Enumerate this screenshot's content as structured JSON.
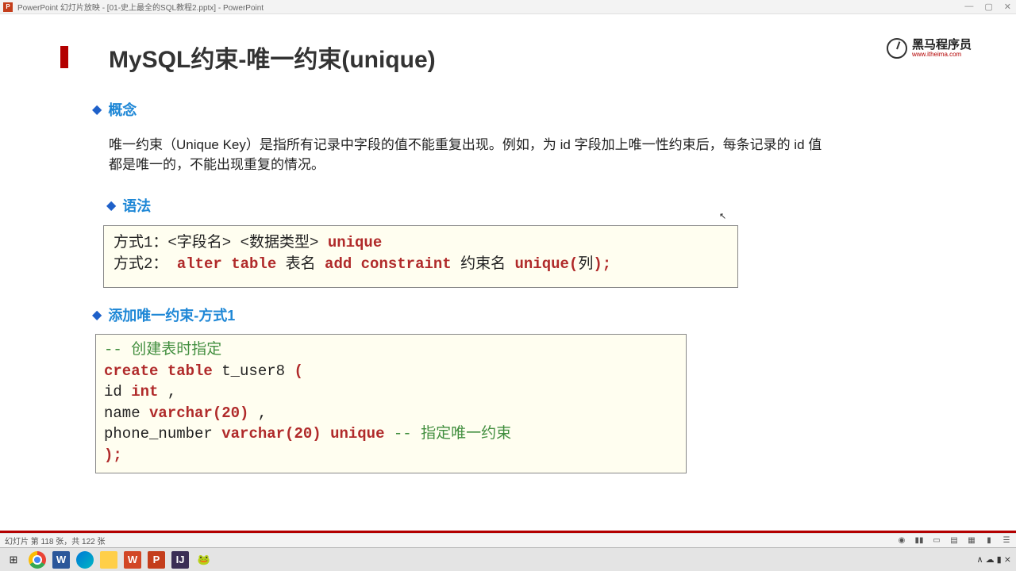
{
  "titlebar": {
    "app_prefix": "PowerPoint 幻灯片放映 - [01-史上最全的SQL教程2.pptx] - PowerPoint",
    "min": "—",
    "max": "▢",
    "close": "✕"
  },
  "slide": {
    "title": "MySQL约束-唯一约束(unique)",
    "logo_text": "黑马程序员",
    "logo_sub": "www.itheima.com",
    "sec1": "概念",
    "para1": "唯一约束（Unique Key）是指所有记录中字段的值不能重复出现。例如，为 id 字段加上唯一性约束后，每条记录的 id 值都是唯一的，不能出现重复的情况。",
    "sec2": "语法",
    "box1": {
      "l1a": "方式1：<字段名> <数据类型> ",
      "l1b": "unique",
      "l2a": "方式2： ",
      "l2b": "alter table",
      "l2c": " 表名 ",
      "l2d": "add constraint",
      "l2e": " 约束名 ",
      "l2f": "unique(",
      "l2g": "列",
      "l2h": ");"
    },
    "sec3": "添加唯一约束-方式1",
    "box2": {
      "c1": "-- 创建表时指定",
      "l2a": "create table",
      "l2b": " t_user8 ",
      "l2c": "(",
      "l3a": " id ",
      "l3b": "int",
      "l3c": " ,",
      "l4a": " name ",
      "l4b": "varchar(",
      "l4c": "20",
      "l4d": ")",
      "l4e": " ,",
      "l5a": " phone_number ",
      "l5b": "varchar(",
      "l5c": "20",
      "l5d": ")",
      "l5e": " ",
      "l5f": "unique",
      "l5g": " ",
      "l5h": "-- 指定唯一约束",
      "l6": ");"
    }
  },
  "statusbar": {
    "left": "幻灯片 第 118 张，共 122 张"
  },
  "taskbar": {
    "tray": "∧ ☁ ▮ ⨯"
  }
}
